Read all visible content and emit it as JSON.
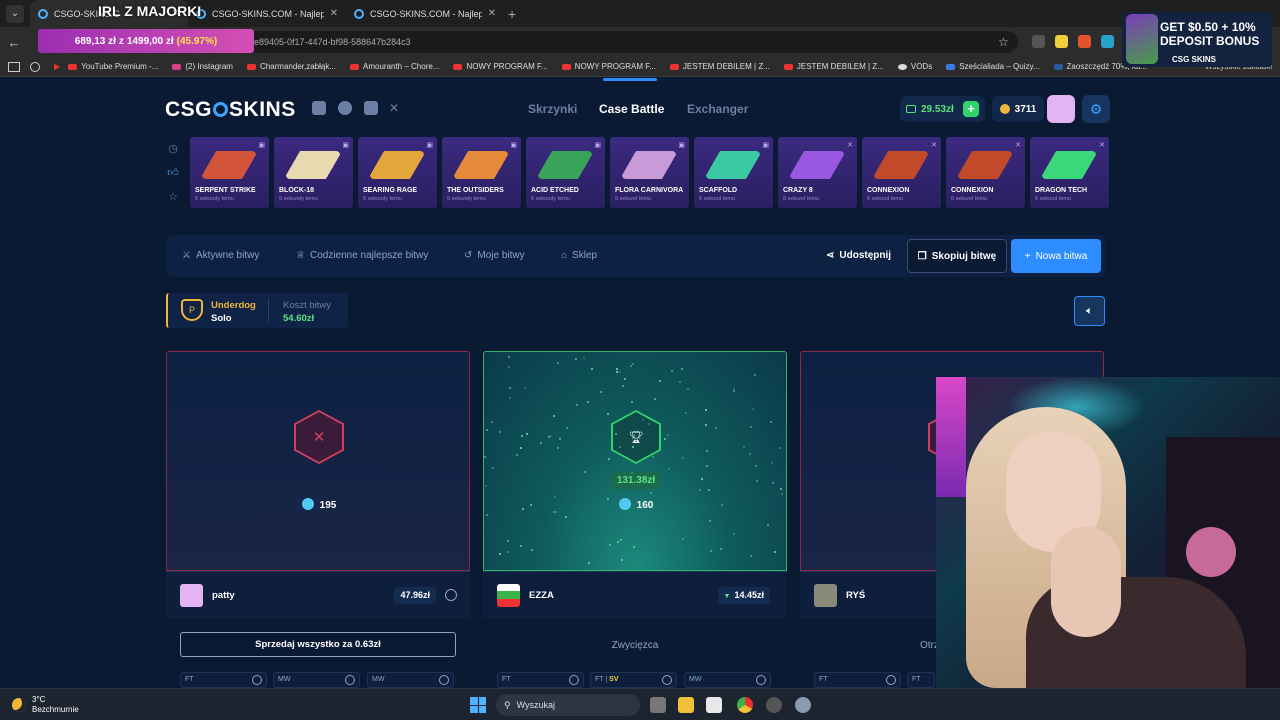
{
  "browser": {
    "tabs": [
      {
        "label": "CSGO-SKINS.C",
        "active": true
      },
      {
        "label": "CSGO-SKINS.COM - Najlepsze",
        "active": false
      },
      {
        "label": "CSGO-SKINS.COM - Najlepsze",
        "active": false
      }
    ],
    "stream_title": "IRL Z MAJORKI",
    "url_tail": "e89405-0f17-447d-bf98-588647b284c3",
    "progress": {
      "current": "689,13 zł",
      "sep": "z",
      "goal": "1499,00 zł",
      "percent": "(45.97%)"
    },
    "bookmarks": [
      "YouTube Premium -...",
      "(2) Instagram",
      "Charmander,zabłąk...",
      "Amouranth – Chore...",
      "NOWY PROGRAM F...",
      "NOWY PROGRAM F...",
      "JESTEM DEBILEM | Z...",
      "JESTEM DEBILEM | Z...",
      "VODs",
      "Sześcialiada – Quizy...",
      "Zaoszczędź 70%, ku..."
    ],
    "all_bookmarks": "Wszystkie zakładki"
  },
  "promo": {
    "line1": "GET $0.50 + 10%",
    "line2": "DEPOSIT BONUS",
    "brand": "CSG SKINS"
  },
  "site": {
    "logo_left": "CSG",
    "logo_right": "SKINS",
    "nav": [
      "Skrzynki",
      "Case Battle",
      "Exchanger"
    ],
    "active_nav": "Case Battle",
    "balance": "29.53zł",
    "coins": "3711"
  },
  "drops": [
    {
      "name": "SERPENT STRIKE",
      "time": "5 sekundy temu",
      "color": "#d2553a"
    },
    {
      "name": "BLOCK-18",
      "time": "5 sekundy temu",
      "color": "#e7d9b0"
    },
    {
      "name": "SEARING RAGE",
      "time": "5 sekundy temu",
      "color": "#e2a63a"
    },
    {
      "name": "THE OUTSIDERS",
      "time": "5 sekundy temu",
      "color": "#e48a3a"
    },
    {
      "name": "ACID ETCHED",
      "time": "6 sekundy temu",
      "color": "#3aa35a"
    },
    {
      "name": "FLORA CARNIVORA",
      "time": "5 sekund temu",
      "color": "#c99ad8"
    },
    {
      "name": "SCAFFOLD",
      "time": "6 sekund temu",
      "color": "#3ac9a3"
    },
    {
      "name": "CRAZY 8",
      "time": "8 sekund temu",
      "color": "#9a58e2"
    },
    {
      "name": "CONNEXION",
      "time": "6 sekund temu",
      "color": "#c24a2a"
    },
    {
      "name": "CONNEXION",
      "time": "6 sekund temu",
      "color": "#c24a2a"
    },
    {
      "name": "DRAGON TECH",
      "time": "6 sekund temu",
      "color": "#3ad87a"
    }
  ],
  "battle_nav": {
    "active": "Aktywne bitwy",
    "daily": "Codzienne najlepsze bitwy",
    "mine": "Moje bitwy",
    "shop": "Sklep",
    "share": "Udostępnij",
    "copy": "Skopiuj bitwę",
    "new": "Nowa bitwa"
  },
  "battle_info": {
    "mode": "Underdog",
    "type": "Solo",
    "cost_label": "Koszt bitwy",
    "cost": "54.60zł"
  },
  "players": [
    {
      "name": "patty",
      "points": "195",
      "value": "47.96zł",
      "result": "loser",
      "avatar_color": "#e3b3f2"
    },
    {
      "name": "EZZA",
      "points": "160",
      "value": "14.45zł",
      "result": "winner",
      "win_amount": "131.38zł",
      "avatar_color": "#3ab34a"
    },
    {
      "name": "RYŚ",
      "points": "",
      "value": "",
      "result": "loser",
      "avatar_color": "#8a8a7a"
    }
  ],
  "actions": {
    "sell_all": "Sprzedaj wszystko za 0.63zł",
    "winner_label": "Zwycięzca",
    "received_label": "Otrzymał nag"
  },
  "skin_chips": [
    {
      "wear": "FT",
      "extra": ""
    },
    {
      "wear": "MW",
      "extra": ""
    },
    {
      "wear": "MW",
      "extra": ""
    },
    {
      "wear": "FT",
      "extra": ""
    },
    {
      "wear": "FT |",
      "extra": "SV"
    },
    {
      "wear": "MW",
      "extra": ""
    },
    {
      "wear": "FT",
      "extra": ""
    },
    {
      "wear": "FT",
      "extra": ""
    }
  ],
  "taskbar": {
    "temp": "3°C",
    "weather": "Bezchmurnie",
    "search": "Wyszukaj"
  }
}
